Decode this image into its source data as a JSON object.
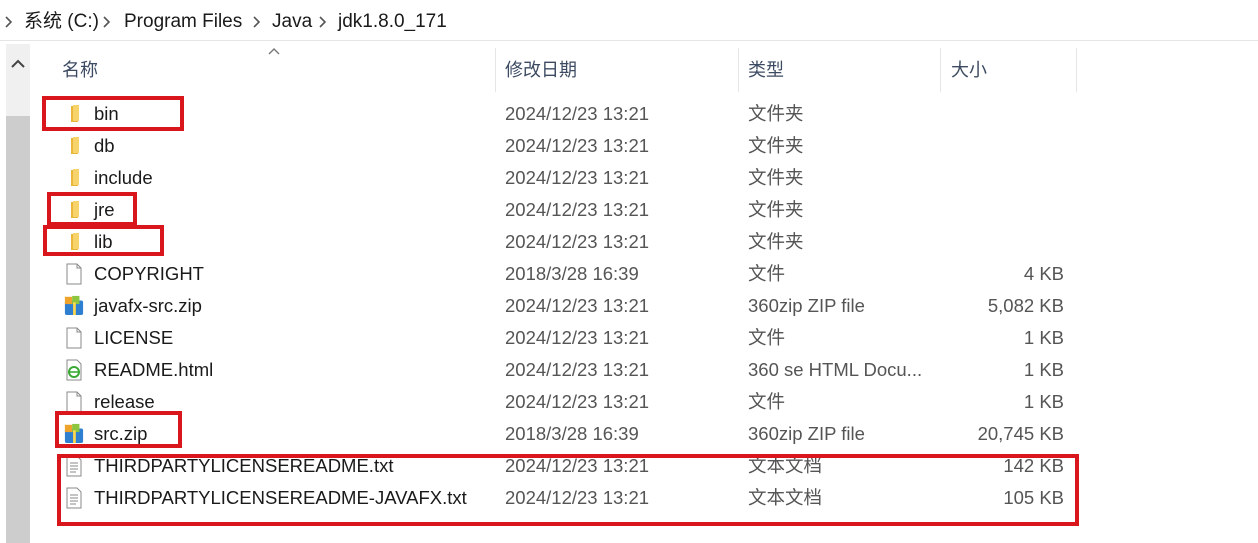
{
  "breadcrumb": {
    "parts": [
      "系统 (C:)",
      "Program Files",
      "Java",
      "jdk1.8.0_171"
    ]
  },
  "columns": {
    "name": "名称",
    "date": "修改日期",
    "type": "类型",
    "size": "大小"
  },
  "files": [
    {
      "name": "bin",
      "date": "2024/12/23 13:21",
      "type": "文件夹",
      "size": "",
      "icon": "folder-icon"
    },
    {
      "name": "db",
      "date": "2024/12/23 13:21",
      "type": "文件夹",
      "size": "",
      "icon": "folder-icon"
    },
    {
      "name": "include",
      "date": "2024/12/23 13:21",
      "type": "文件夹",
      "size": "",
      "icon": "folder-icon"
    },
    {
      "name": "jre",
      "date": "2024/12/23 13:21",
      "type": "文件夹",
      "size": "",
      "icon": "folder-icon"
    },
    {
      "name": "lib",
      "date": "2024/12/23 13:21",
      "type": "文件夹",
      "size": "",
      "icon": "folder-icon"
    },
    {
      "name": "COPYRIGHT",
      "date": "2018/3/28 16:39",
      "type": "文件",
      "size": "4 KB",
      "icon": "blank-file-icon"
    },
    {
      "name": "javafx-src.zip",
      "date": "2024/12/23 13:21",
      "type": "360zip ZIP file",
      "size": "5,082 KB",
      "icon": "zip-archive-icon"
    },
    {
      "name": "LICENSE",
      "date": "2024/12/23 13:21",
      "type": "文件",
      "size": "1 KB",
      "icon": "blank-file-icon"
    },
    {
      "name": "README.html",
      "date": "2024/12/23 13:21",
      "type": "360 se HTML Docu...",
      "size": "1 KB",
      "icon": "html-browser-icon"
    },
    {
      "name": "release",
      "date": "2024/12/23 13:21",
      "type": "文件",
      "size": "1 KB",
      "icon": "blank-file-icon"
    },
    {
      "name": "src.zip",
      "date": "2018/3/28 16:39",
      "type": "360zip ZIP file",
      "size": "20,745 KB",
      "icon": "zip-archive-icon"
    },
    {
      "name": "THIRDPARTYLICENSEREADME.txt",
      "date": "2024/12/23 13:21",
      "type": "文本文档",
      "size": "142 KB",
      "icon": "text-document-icon"
    },
    {
      "name": "THIRDPARTYLICENSEREADME-JAVAFX.txt",
      "date": "2024/12/23 13:21",
      "type": "文本文档",
      "size": "105 KB",
      "icon": "text-document-icon"
    }
  ],
  "highlighted": [
    "bin",
    "jre",
    "lib",
    "src.zip",
    "THIRDPARTYLICENSEREADME.txt",
    "THIRDPARTYLICENSEREADME-JAVAFX.txt"
  ],
  "colors": {
    "highlight": "#d8161b",
    "folder": "#f2c94c",
    "header_text": "#3d4b62"
  }
}
